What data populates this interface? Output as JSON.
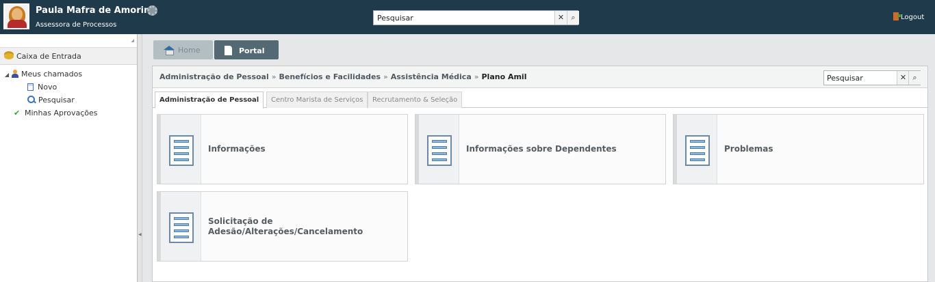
{
  "header": {
    "user_name": "Paula Mafra de Amorim",
    "user_role": "Assessora de Processos",
    "search": {
      "value": "Pesquisar",
      "clear_glyph": "✕",
      "search_glyph": "⌕"
    },
    "logout_label": "Logout",
    "colors": {
      "bar": "#1f3a4a"
    }
  },
  "sidebar": {
    "inbox_label": "Caixa de Entrada",
    "tree": [
      {
        "label": "Meus chamados",
        "icon": "person-icon",
        "expanded": true
      },
      {
        "label": "Novo",
        "icon": "document-icon"
      },
      {
        "label": "Pesquisar",
        "icon": "magnifier-icon"
      },
      {
        "label": "Minhas Aprovações",
        "icon": "check-icon"
      }
    ]
  },
  "top_tabs": [
    {
      "label": "Home",
      "icon": "home-icon",
      "active": false
    },
    {
      "label": "Portal",
      "icon": "page-icon",
      "active": true
    }
  ],
  "breadcrumb": {
    "items": [
      "Administração de Pessoal",
      "Benefícios e Facilidades",
      "Assistência Médica"
    ],
    "current": "Plano Amil",
    "separator": "»"
  },
  "portal_search": {
    "value": "Pesquisar"
  },
  "sub_tabs": [
    {
      "label": "Administração de Pessoal",
      "active": true
    },
    {
      "label": "Centro Marista de Serviços",
      "active": false
    },
    {
      "label": "Recrutamento & Seleção",
      "active": false
    }
  ],
  "cards": [
    {
      "title": "Informações",
      "icon": "form-icon"
    },
    {
      "title": "Informações sobre Dependentes",
      "icon": "form-icon"
    },
    {
      "title": "Problemas",
      "icon": "form-icon"
    },
    {
      "title": "Solicitação de Adesão/Alterações/Cancelamento",
      "icon": "form-icon"
    }
  ]
}
